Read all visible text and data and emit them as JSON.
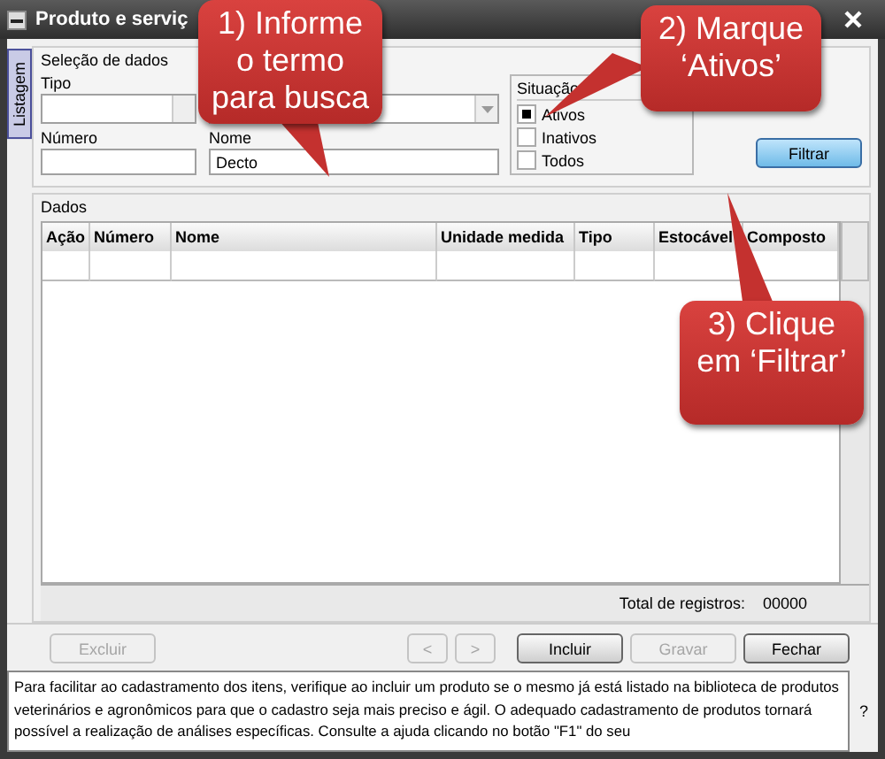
{
  "window": {
    "title": "Produto e serviç"
  },
  "side_tabs": [
    {
      "label": "Listagem",
      "selected": true
    }
  ],
  "selection": {
    "title": "Seleção de dados",
    "tipo": {
      "label": "Tipo"
    },
    "numero": {
      "label": "Número"
    },
    "nome": {
      "label": "Nome",
      "value": "Decto"
    },
    "situacao": {
      "title": "Situação",
      "options": [
        {
          "label": "Ativos",
          "checked": true
        },
        {
          "label": "Inativos",
          "checked": false
        },
        {
          "label": "Todos",
          "checked": false
        }
      ]
    },
    "filter_button": "Filtrar"
  },
  "data": {
    "title": "Dados",
    "columns": [
      "Ação",
      "Número",
      "Nome",
      "Unidade medida",
      "Tipo",
      "Estocável",
      "Composto"
    ],
    "total_label": "Total de registros:",
    "total": "00000"
  },
  "buttons": [
    {
      "label": "Excluir",
      "disabled": true
    },
    {
      "label": "<",
      "disabled": true
    },
    {
      "label": ">",
      "disabled": true
    },
    {
      "label": "Incluir",
      "disabled": false
    },
    {
      "label": "Gravar",
      "disabled": true
    },
    {
      "label": "Fechar",
      "disabled": false
    }
  ],
  "hint": {
    "text": "Para facilitar ao cadastramento dos itens, verifique ao incluir um produto se o mesmo já está listado na biblioteca de produtos veterinários e agronômicos para que o cadastro seja mais preciso e ágil. O adequado cadastramento de produtos tornará possível a realização de análises específicas. Consulte a ajuda clicando no botão \"F1\" do seu",
    "help": "?"
  },
  "callouts": [
    {
      "text": "1) Informe o termo para busca"
    },
    {
      "text": "2) Marque ‘Ativos’"
    },
    {
      "text": "3) Clique em ‘Filtrar’"
    }
  ]
}
